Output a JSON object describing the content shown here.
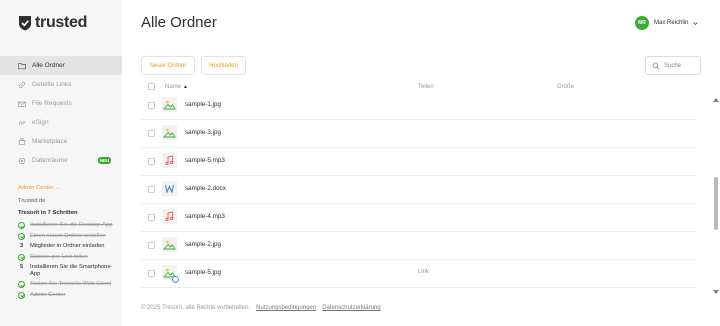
{
  "app": {
    "logo_text": "trusted"
  },
  "sidebar": {
    "items": [
      {
        "label": "Alle Ordner",
        "icon": "folder-icon",
        "active": true
      },
      {
        "label": "Geteilte Links",
        "icon": "link-icon"
      },
      {
        "label": "File Requests",
        "icon": "file-request-icon"
      },
      {
        "label": "eSign",
        "icon": "esign-icon"
      },
      {
        "label": "Marketplace",
        "icon": "marketplace-icon"
      },
      {
        "label": "Datenräume",
        "icon": "datarooms-icon",
        "badge": "NEU"
      }
    ],
    "admin_center": "Admin Center →",
    "org_name": "Trusted.de",
    "steps_title": "Tresorit in 7 Schritten",
    "steps": [
      {
        "text": "Installieren Sie die Desktop-App",
        "done": true
      },
      {
        "text": "Einen neuen Ordner erstellen",
        "done": true
      },
      {
        "num": "3",
        "text": "Mitglieder in Ordner einladen",
        "done": false
      },
      {
        "text": "Dateien per Link teilen",
        "done": true
      },
      {
        "num": "5",
        "text": "Installieren Sie die Smartphone-App",
        "done": false
      },
      {
        "text": "Testen Sie Tresorits Web-Client",
        "done": true
      },
      {
        "text": "Admin Center",
        "done": true
      }
    ]
  },
  "header": {
    "title": "Alle Ordner",
    "user_initials": "MR",
    "user_name": "Max Reichlin"
  },
  "toolbar": {
    "new_folder_label": "Neuer Ordner",
    "upload_label": "Hochladen",
    "search_placeholder": "Suche"
  },
  "table": {
    "columns": {
      "name": "Name",
      "share": "Teilen",
      "size": "Größe"
    },
    "rows": [
      {
        "name": "sample-1.jpg",
        "type": "image",
        "share": ""
      },
      {
        "name": "sample-3.jpg",
        "type": "image",
        "share": ""
      },
      {
        "name": "sample-5.mp3",
        "type": "audio",
        "share": ""
      },
      {
        "name": "sample-2.docx",
        "type": "word",
        "share": ""
      },
      {
        "name": "sample-4.mp3",
        "type": "audio",
        "share": ""
      },
      {
        "name": "sample-2.jpg",
        "type": "image",
        "share": ""
      },
      {
        "name": "sample-5.jpg",
        "type": "image-linked",
        "share": "Link"
      }
    ]
  },
  "footer": {
    "copyright": "© 2025 Tresorit, alle Rechte vorbehalten.",
    "terms": "Nutzungsbedingungen",
    "privacy": "Datenschutzerklärung"
  },
  "colors": {
    "accent": "#f29a2e",
    "green": "#3aaa35",
    "sidebar_bg": "#f6f6f6",
    "active_bg": "#e4e4e4"
  }
}
